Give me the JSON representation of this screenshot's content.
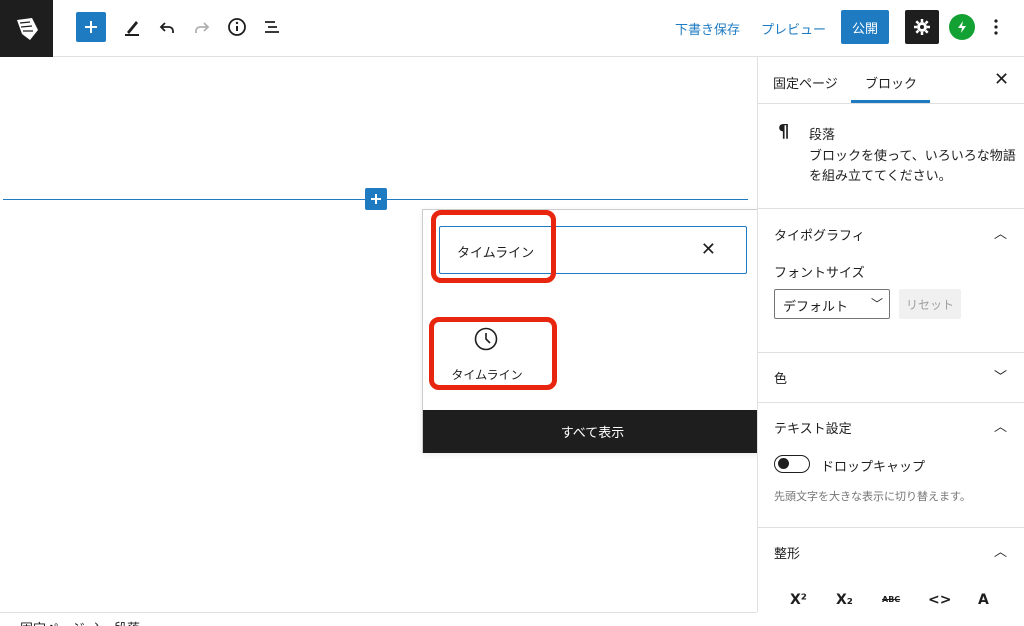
{
  "toolbar": {
    "save_draft": "下書き保存",
    "preview": "プレビュー",
    "publish": "公開"
  },
  "inserter": {
    "search_value": "タイムライン",
    "result_label": "タイムライン",
    "show_all": "すべて表示"
  },
  "sidebar": {
    "tabs": [
      "固定ページ",
      "ブロック"
    ],
    "active_tab": "ブロック",
    "block_title": "段落",
    "block_desc_line1": "ブロックを使って、いろいろな物語",
    "block_desc_line2": "を組み立ててください。",
    "typography": {
      "title": "タイポグラフィ",
      "font_size_label": "フォントサイズ",
      "font_size_value": "デフォルト",
      "reset": "リセット"
    },
    "color": {
      "title": "色"
    },
    "text_settings": {
      "title": "テキスト設定",
      "drop_cap": "ドロップキャップ",
      "help": "先頭文字を大きな表示に切り替えます。"
    },
    "formatting": {
      "title": "整形",
      "buttons": [
        "X²",
        "X₂",
        "ABC",
        "<>",
        "A"
      ]
    }
  },
  "breadcrumb": [
    "固定ページ",
    "段落"
  ],
  "colors": {
    "accent": "#1e7bc2",
    "highlight": "#e8250e",
    "dark": "#1e1e1e",
    "jetpack": "#13a133"
  }
}
